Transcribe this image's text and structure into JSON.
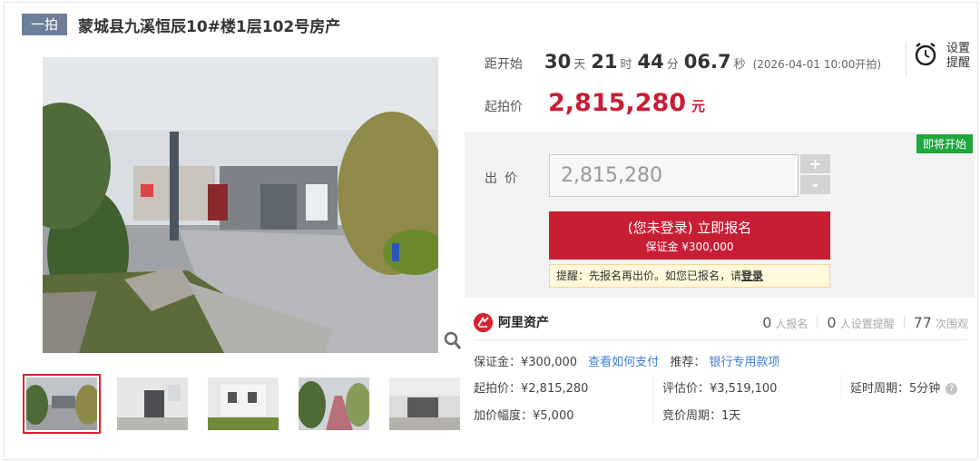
{
  "title": {
    "tag": "一拍",
    "text": "蒙城县九溪恒辰10#楼1层102号房产"
  },
  "countdown": {
    "label": "距开始",
    "days": "30",
    "days_unit": "天",
    "hours": "21",
    "hours_unit": "时",
    "minutes": "44",
    "minutes_unit": "分",
    "seconds": "06.7",
    "seconds_unit": "秒",
    "start_note": "(2026-04-01 10:00开拍)"
  },
  "reminder": {
    "icon": "alarm-clock-icon",
    "label": "设置提醒"
  },
  "start_price": {
    "label": "起拍价",
    "value": "2,815,280",
    "unit": "元"
  },
  "bid": {
    "status_badge": "即将开始",
    "label": "出价",
    "input_value": "2,815,280",
    "plus": "+",
    "minus": "-",
    "signup_main": "(您未登录) 立即报名",
    "signup_sub": "保证金 ¥300,000",
    "tip_text": "提醒：先报名再出价。如您已报名，请",
    "tip_link": "登录"
  },
  "platform": {
    "logo_icon": "ali-assets-logo-icon",
    "name": "阿里资产",
    "signups_count": "0",
    "signups_label": "人报名",
    "reminders_count": "0",
    "reminders_label": "人设置提醒",
    "views_count": "77",
    "views_label": "次围观"
  },
  "details": {
    "deposit": "保证金：¥300,000",
    "how_to_pay": "查看如何支付",
    "recommend_label": "推荐：",
    "recommend_link": "银行专用款项",
    "start_price": "起拍价：¥2,815,280",
    "appraisal": "评估价：¥3,519,100",
    "delay_period": "延时周期：5分钟",
    "increment": "加价幅度：¥5,000",
    "bid_period": "竞价周期：1天"
  },
  "colors": {
    "accent_red": "#c81e34",
    "badge_green": "#1fa83d",
    "tag_gray_blue": "#6e7e98",
    "link_blue": "#3b7fd6"
  }
}
